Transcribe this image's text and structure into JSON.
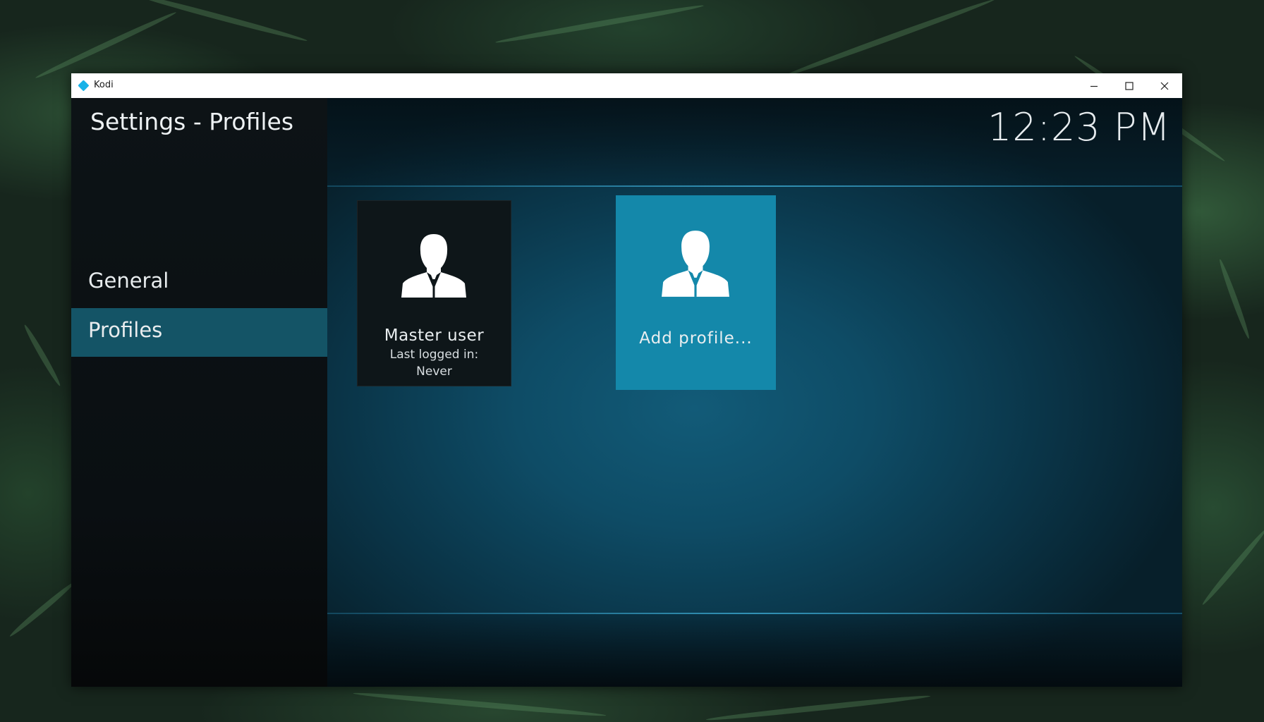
{
  "window": {
    "app_title": "Kodi",
    "controls": {
      "minimize_icon": "minimize-icon",
      "maximize_icon": "maximize-icon",
      "close_icon": "close-icon"
    }
  },
  "sidebar": {
    "title": "Settings - Profiles",
    "items": [
      {
        "label": "General",
        "selected": false
      },
      {
        "label": "Profiles",
        "selected": true
      }
    ]
  },
  "header": {
    "clock": "12:23 PM"
  },
  "profiles": {
    "tiles": [
      {
        "name": "Master user",
        "last_logged_label": "Last logged in:",
        "last_logged_value": "Never",
        "icon": "user-icon"
      },
      {
        "label": "Add profile...",
        "icon": "user-icon",
        "focused": true
      }
    ]
  },
  "colors": {
    "accent": "#1488aa",
    "selected_nav": "#145466",
    "sidebar_bg": "#0b1014",
    "main_bg": "#0e4c66",
    "titlebar_bg": "#ffffff"
  }
}
